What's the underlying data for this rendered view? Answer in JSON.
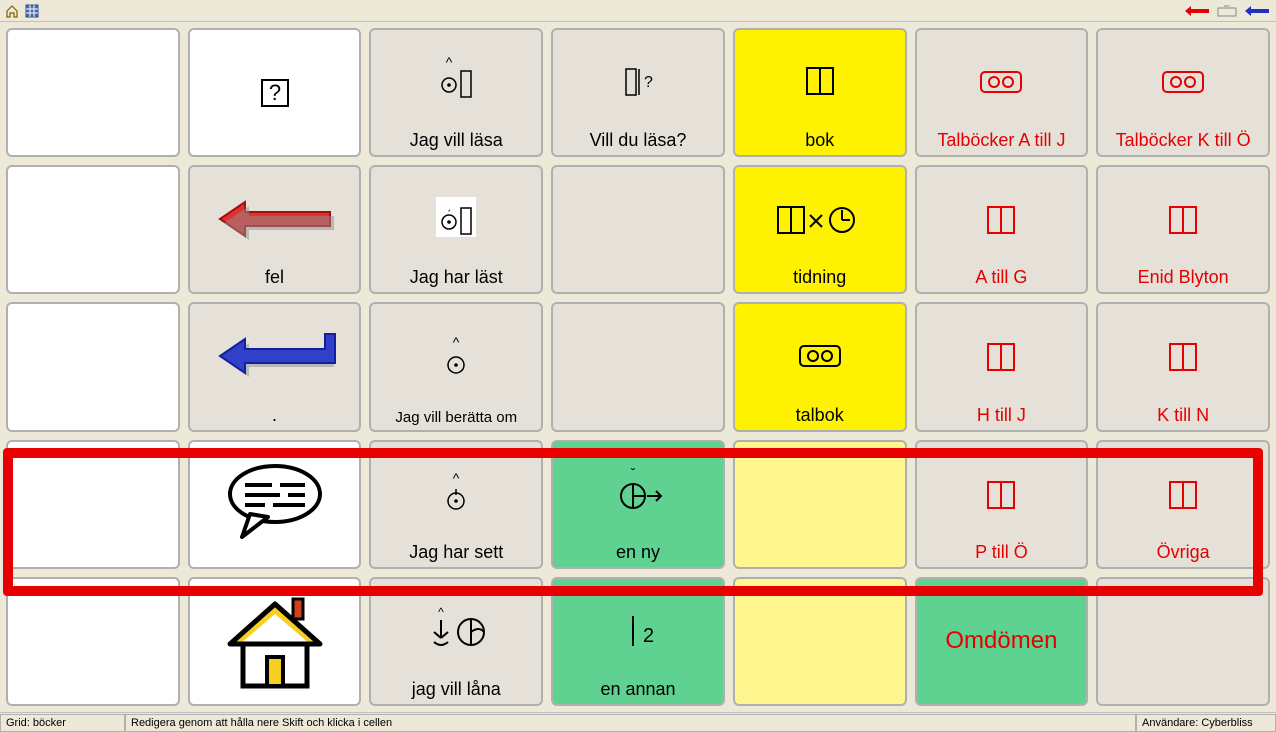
{
  "toolbar": {},
  "grid": {
    "r0": {
      "c1": {
        "label": ""
      },
      "c2": {
        "label": "Jag vill läsa"
      },
      "c3": {
        "label": "Vill du läsa?"
      },
      "c4": {
        "label": "bok"
      },
      "c5": {
        "label": "Talböcker A till J"
      },
      "c6": {
        "label": "Talböcker K till Ö"
      }
    },
    "r1": {
      "c1": {
        "label": "fel"
      },
      "c2": {
        "label": "Jag har läst"
      },
      "c4": {
        "label": "tidning"
      },
      "c5": {
        "label": "A till G"
      },
      "c6": {
        "label": "Enid Blyton"
      }
    },
    "r2": {
      "c1": {
        "label": "."
      },
      "c2": {
        "label": "Jag vill berätta om"
      },
      "c4": {
        "label": "talbok"
      },
      "c5": {
        "label": "H till J"
      },
      "c6": {
        "label": "K till N"
      }
    },
    "r3": {
      "c2": {
        "label": "Jag har sett"
      },
      "c3": {
        "label": "en ny"
      },
      "c5": {
        "label": "P till Ö"
      },
      "c6": {
        "label": "Övriga"
      }
    },
    "r4": {
      "c2": {
        "label": "jag vill låna"
      },
      "c3": {
        "label": "en annan"
      },
      "c5": {
        "label": "Omdömen"
      }
    }
  },
  "status": {
    "grid_name": "Grid: böcker",
    "hint": "Redigera genom att hålla nere Skift och klicka i cellen",
    "user": "Användare: Cyberbliss"
  }
}
